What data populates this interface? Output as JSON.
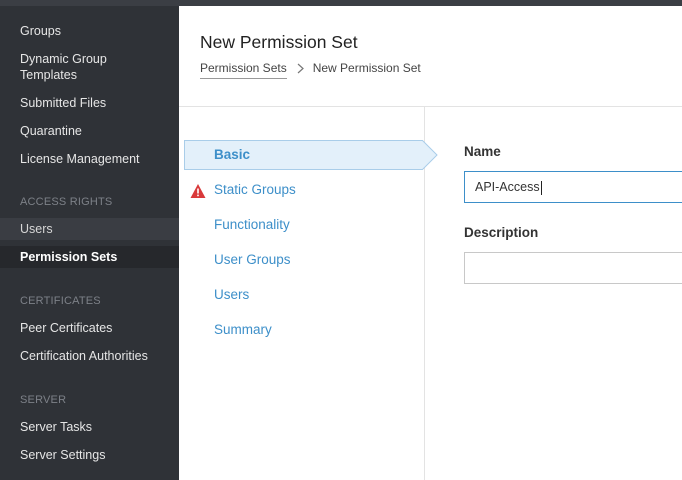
{
  "sidebar": {
    "items": [
      {
        "label": "Groups"
      },
      {
        "label": "Dynamic Group Templates"
      },
      {
        "label": "Submitted Files"
      },
      {
        "label": "Quarantine"
      },
      {
        "label": "License Management"
      }
    ],
    "sections": [
      {
        "title": "ACCESS RIGHTS",
        "items": [
          {
            "label": "Users"
          },
          {
            "label": "Permission Sets"
          }
        ]
      },
      {
        "title": "CERTIFICATES",
        "items": [
          {
            "label": "Peer Certificates"
          },
          {
            "label": "Certification Authorities"
          }
        ]
      },
      {
        "title": "SERVER",
        "items": [
          {
            "label": "Server Tasks"
          },
          {
            "label": "Server Settings"
          }
        ]
      }
    ],
    "active_item": "Permission Sets"
  },
  "header": {
    "title": "New Permission Set",
    "breadcrumb": {
      "parent": "Permission Sets",
      "current": "New Permission Set"
    }
  },
  "wizard": {
    "steps": [
      {
        "label": "Basic",
        "active": true
      },
      {
        "label": "Static Groups",
        "warning": true
      },
      {
        "label": "Functionality"
      },
      {
        "label": "User Groups"
      },
      {
        "label": "Users"
      },
      {
        "label": "Summary"
      }
    ]
  },
  "form": {
    "name_label": "Name",
    "name_value": "API-Access",
    "description_label": "Description",
    "description_value": ""
  },
  "colors": {
    "sidebar_bg": "#2f3237",
    "accent": "#3d8fc9",
    "active_step_bg": "#e3f0fa",
    "warning": "#d9393a"
  }
}
